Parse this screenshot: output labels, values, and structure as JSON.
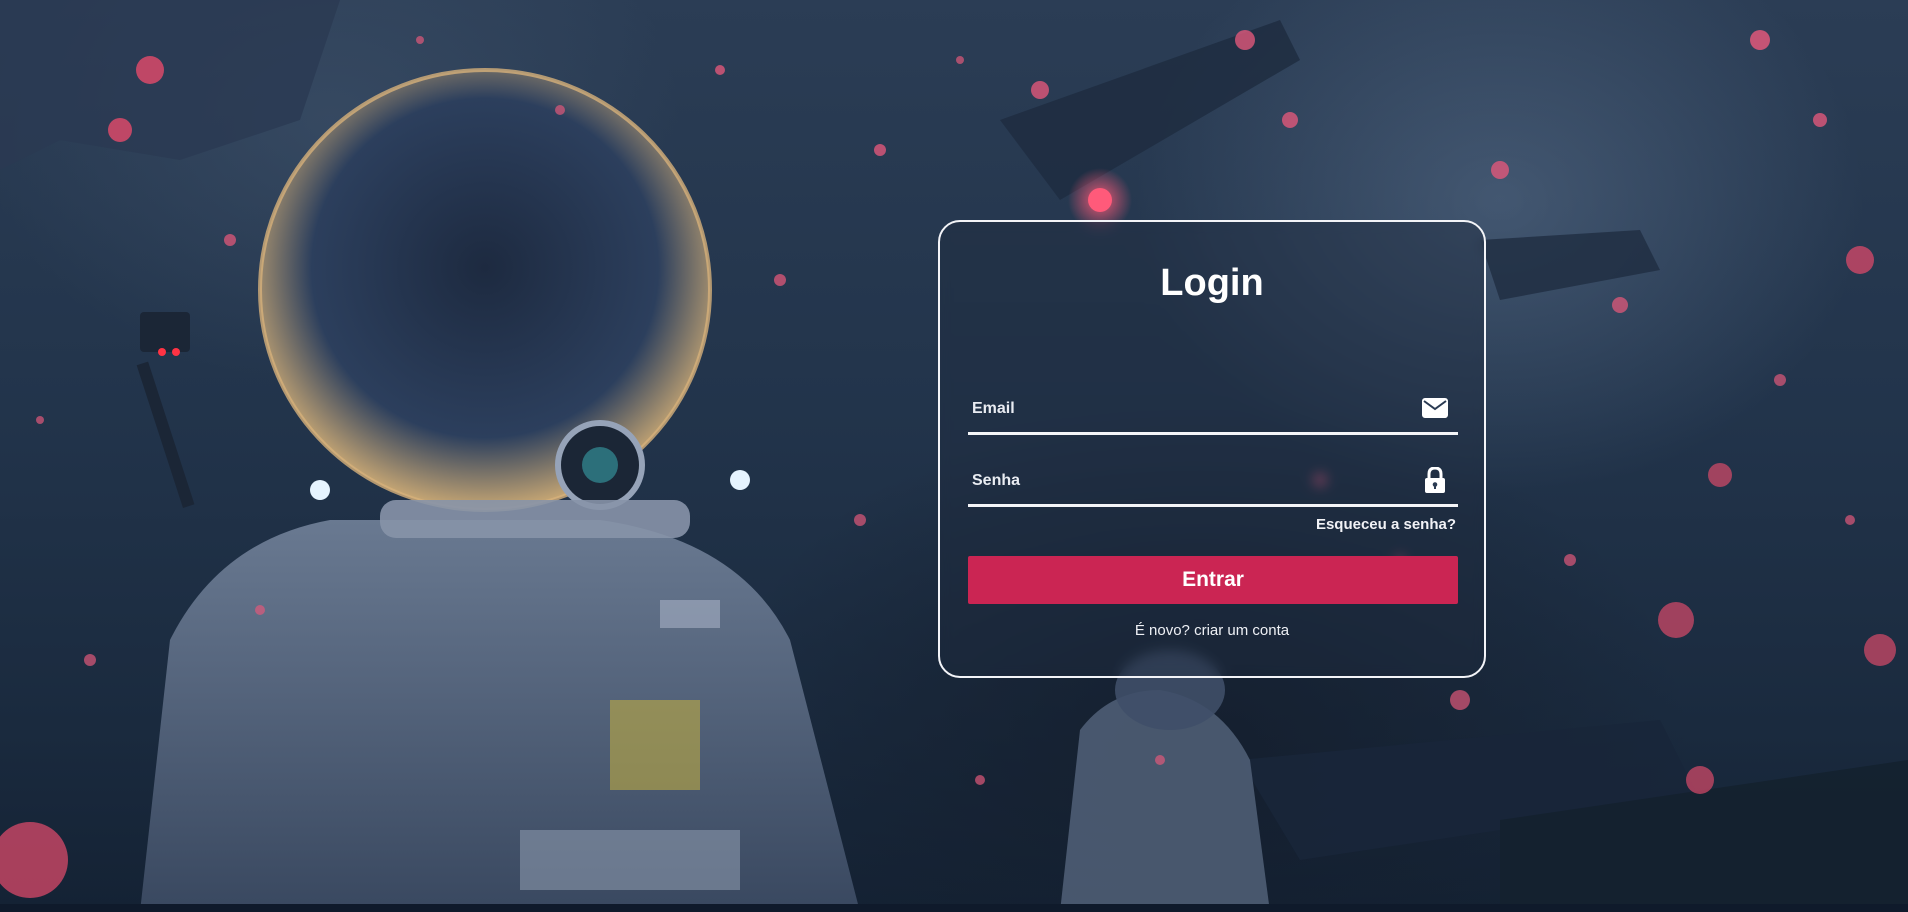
{
  "background": {
    "description_icon": "astronaut-space-scene",
    "accent_color": "#cb2553"
  },
  "login": {
    "title": "Login",
    "email": {
      "placeholder": "Email",
      "value": "",
      "icon": "envelope-icon"
    },
    "password": {
      "placeholder": "Senha",
      "value": "",
      "icon": "lock-icon"
    },
    "forgot_label": "Esqueceu a senha?",
    "submit_label": "Entrar",
    "signup_question": "É novo?",
    "signup_link": "criar um conta"
  }
}
